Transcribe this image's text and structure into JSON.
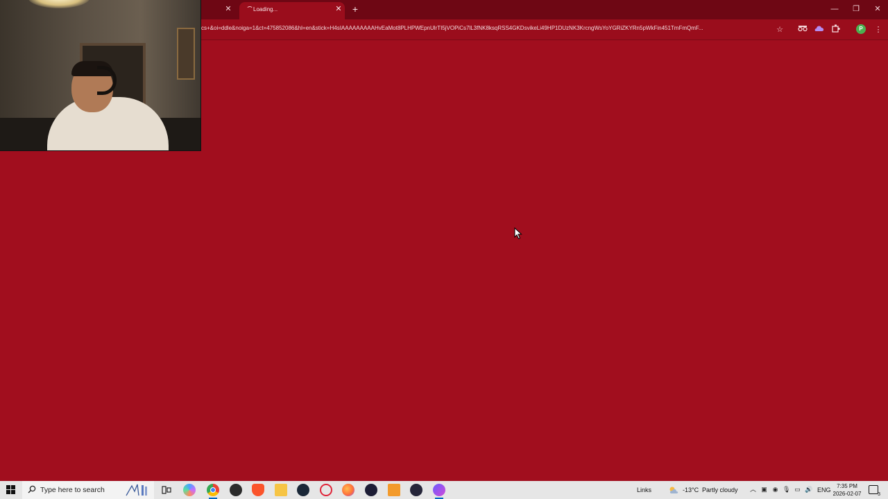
{
  "browser": {
    "active_tab": {
      "title": "Loading..."
    },
    "address_bar": {
      "url": "cs+&oi=ddle&noiga=1&ct=475852086&hl=en&stick=H4sIAAAAAAAAAHvEaMot8PLHPWEpnUlrTI5jVOPiCs7lL3fNK8ksqRSS4GKDsvikeLi49HP1DUzNK3KrcngWsYoYGRiZKYRn5pWkFin451TmFmQmF..."
    },
    "profile_initial": "P",
    "accent_color": "#a10e1e"
  },
  "taskbar": {
    "search_placeholder": "Type here to search",
    "links_label": "Links",
    "weather": {
      "temp": "-13°C",
      "condition": "Partly cloudy"
    },
    "language": "ENG",
    "clock": {
      "time": "7:35 PM",
      "date": "2026-02-07"
    },
    "notification_count": "3",
    "apps": [
      "task-view",
      "copilot",
      "chrome",
      "app-dark",
      "brave",
      "file-explorer",
      "steam",
      "opera",
      "firefox",
      "media-player",
      "app-orange",
      "app-arrow",
      "app-purple"
    ]
  }
}
